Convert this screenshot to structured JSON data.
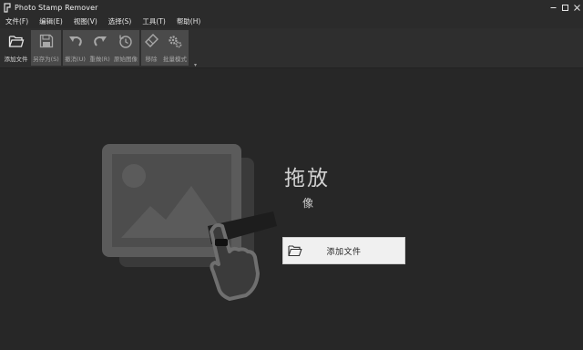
{
  "window": {
    "title": "Photo Stamp Remover",
    "app_icon": "app-logo-icon",
    "controls": [
      "minimize-icon",
      "maximize-icon",
      "close-icon"
    ]
  },
  "menu": [
    {
      "label": "文件(F)"
    },
    {
      "label": "编辑(E)"
    },
    {
      "label": "视图(V)"
    },
    {
      "label": "选择(S)"
    },
    {
      "label": "工具(T)"
    },
    {
      "label": "帮助(H)"
    }
  ],
  "toolbar": {
    "buttons": [
      {
        "label": "添加文件",
        "icon": "folder-open-icon",
        "enabled": true
      },
      {
        "label": "另存为(S)",
        "icon": "floppy-disk-icon",
        "enabled": false
      },
      {
        "label": "撤消(U)",
        "icon": "undo-icon",
        "enabled": false
      },
      {
        "label": "重做(R)",
        "icon": "redo-icon",
        "enabled": false
      },
      {
        "label": "原始图像",
        "icon": "clock-history-icon",
        "enabled": false
      },
      {
        "label": "移除",
        "icon": "eraser-icon",
        "enabled": false
      },
      {
        "label": "批量模式",
        "icon": "gears-icon",
        "enabled": false
      }
    ],
    "overflow_icon": "chevron-down-icon"
  },
  "drop_zone": {
    "title": "拖放",
    "subtitle": "像",
    "add_button_label": "添加文件",
    "add_button_icon": "folder-open-icon",
    "illustration": "image-placeholder-icon",
    "cursor": "hand-cursor-icon"
  },
  "colors": {
    "background": "#272727",
    "toolbar_group": "#4a4a4a",
    "button_light": "#f0f0f0",
    "text_light": "#d2d2d2"
  }
}
